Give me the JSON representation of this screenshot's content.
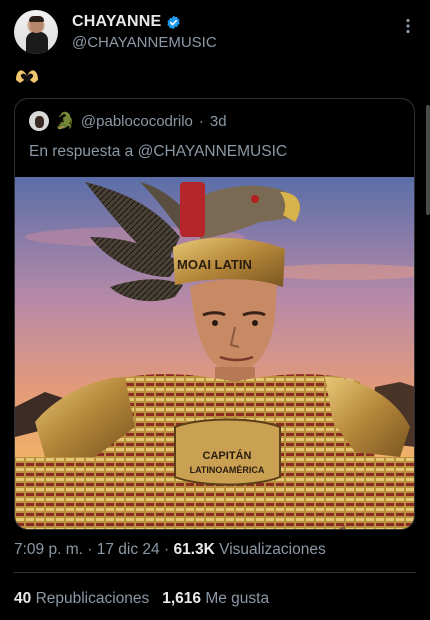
{
  "author": {
    "name": "CHAYANNE",
    "handle": "@CHAYANNEMUSIC"
  },
  "tweet": {
    "icon": "heart-hands-icon"
  },
  "quote": {
    "handle": "@pablococodrilo",
    "separator": "·",
    "time": "3d",
    "reply_prefix": "En respuesta a",
    "reply_to": "@CHAYANNEMUSIC",
    "image": {
      "helmet_text": "MOAI LATIN",
      "chest_text_line1": "CAPITÁN",
      "chest_text_line2": "LATINOAMÉRICA"
    }
  },
  "meta": {
    "time": "7:09 p. m.",
    "separator": "·",
    "date": "17 dic 24",
    "views_count": "61.3K",
    "views_label": "Visualizaciones"
  },
  "stats": {
    "reposts_count": "40",
    "reposts_label": "Republicaciones",
    "likes_count": "1,616",
    "likes_label": "Me gusta"
  },
  "colors": {
    "background": "#000000",
    "text": "#e7e9ea",
    "muted": "#8b98a5",
    "verified": "#1d9bf0",
    "border": "#2f3336"
  }
}
